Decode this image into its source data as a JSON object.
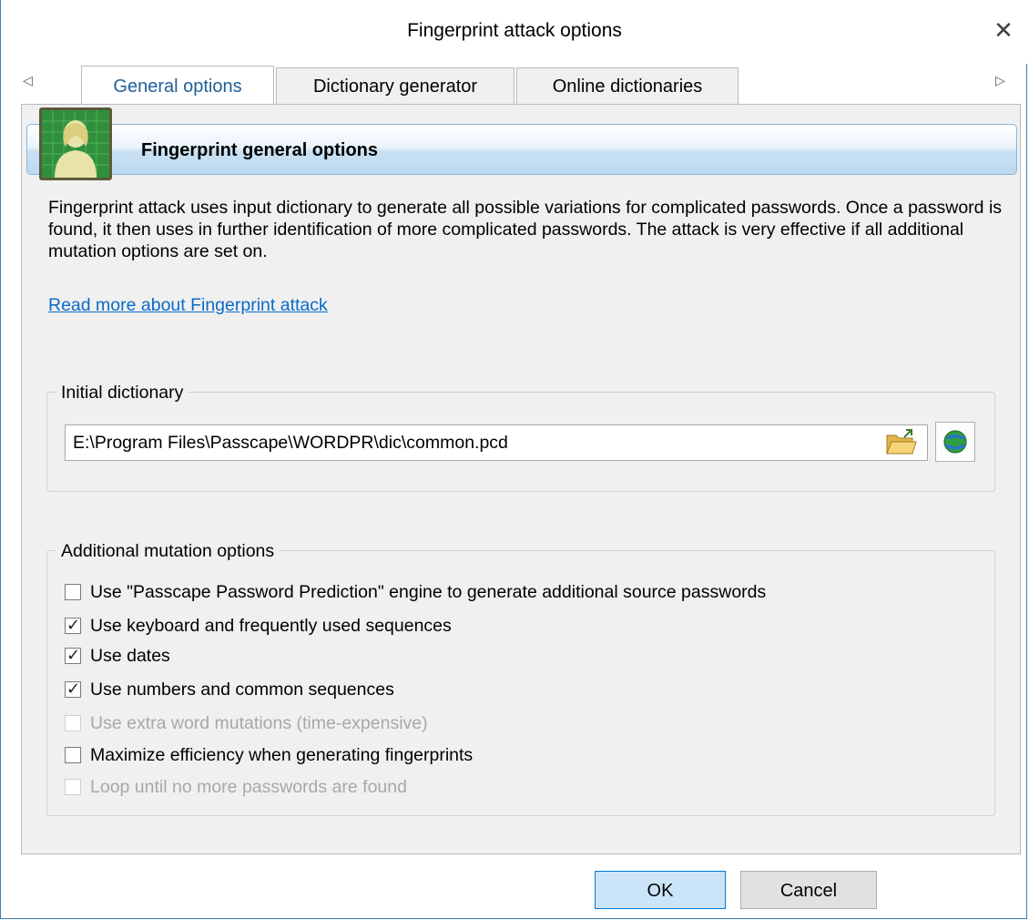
{
  "window": {
    "title": "Fingerprint attack options"
  },
  "tabs": [
    {
      "label": "General options",
      "active": true
    },
    {
      "label": "Dictionary generator",
      "active": false
    },
    {
      "label": "Online dictionaries",
      "active": false
    }
  ],
  "header": {
    "title": "Fingerprint general options"
  },
  "description": "Fingerprint attack uses input dictionary to generate all possible variations for complicated passwords. Once a password is found, it then uses in further identification of more complicated passwords. The attack is very effective if all additional mutation options are set on.",
  "read_more_link": "Read more about Fingerprint attack",
  "initial_dictionary": {
    "label": "Initial dictionary",
    "path": "E:\\Program Files\\Passcape\\WORDPR\\dic\\common.pcd"
  },
  "mutation_options": {
    "label": "Additional mutation options",
    "items": [
      {
        "label": "Use \"Passcape Password Prediction\" engine to generate additional source passwords",
        "checked": false,
        "enabled": true
      },
      {
        "label": "Use keyboard and frequently used sequences",
        "checked": true,
        "enabled": true
      },
      {
        "label": "Use dates",
        "checked": true,
        "enabled": true
      },
      {
        "label": "Use numbers and common sequences",
        "checked": true,
        "enabled": true
      },
      {
        "label": "Use extra word mutations (time-expensive)",
        "checked": false,
        "enabled": false
      },
      {
        "label": "Maximize efficiency when generating fingerprints",
        "checked": false,
        "enabled": true
      },
      {
        "label": "Loop until no more passwords are found",
        "checked": false,
        "enabled": false
      }
    ]
  },
  "buttons": {
    "ok": "OK",
    "cancel": "Cancel"
  },
  "colors": {
    "accent": "#0078d7",
    "link": "#0b6bc9",
    "active_tab_text": "#1f5f9a"
  },
  "icons": {
    "close": "close-icon",
    "folder": "folder-open-icon",
    "globe": "globe-icon",
    "fingerprint": "fingerprint-user-icon"
  }
}
